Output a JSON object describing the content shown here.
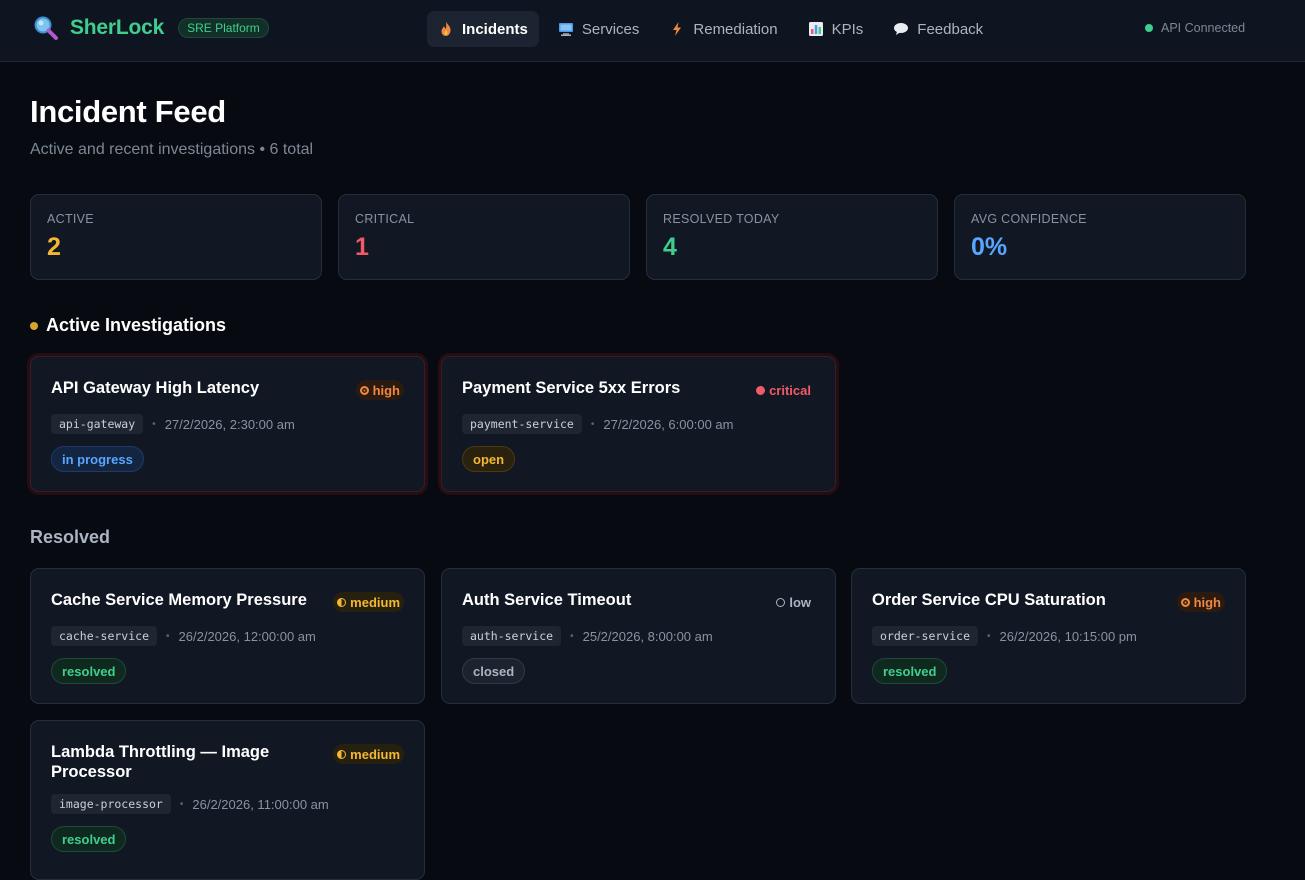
{
  "brand": {
    "name": "SherLock",
    "badge": "SRE Platform"
  },
  "nav": {
    "items": [
      {
        "label": "Incidents",
        "icon": "fire-icon"
      },
      {
        "label": "Services",
        "icon": "computer-icon"
      },
      {
        "label": "Remediation",
        "icon": "lightning-icon"
      },
      {
        "label": "KPIs",
        "icon": "bar-chart-icon"
      },
      {
        "label": "Feedback",
        "icon": "speech-bubble-icon"
      }
    ],
    "active": "Incidents"
  },
  "api_status": "API Connected",
  "header": {
    "title": "Incident Feed",
    "subtitle": "Active and recent investigations • 6 total"
  },
  "stats": [
    {
      "label": "ACTIVE",
      "value": "2",
      "color": "#f5b731"
    },
    {
      "label": "CRITICAL",
      "value": "1",
      "color": "#f25a67"
    },
    {
      "label": "RESOLVED TODAY",
      "value": "4",
      "color": "#3ecf8e"
    },
    {
      "label": "AVG CONFIDENCE",
      "value": "0%",
      "color": "#58a6ff"
    }
  ],
  "sections": {
    "active": "Active Investigations",
    "resolved": "Resolved"
  },
  "active_incidents": [
    {
      "title": "API Gateway High Latency",
      "severity": "high",
      "service": "api-gateway",
      "time": "27/2/2026, 2:30:00 am",
      "status": "in progress"
    },
    {
      "title": "Payment Service 5xx Errors",
      "severity": "critical",
      "service": "payment-service",
      "time": "27/2/2026, 6:00:00 am",
      "status": "open"
    }
  ],
  "resolved_incidents": [
    {
      "title": "Cache Service Memory Pressure",
      "severity": "medium",
      "service": "cache-service",
      "time": "26/2/2026, 12:00:00 am",
      "status": "resolved"
    },
    {
      "title": "Auth Service Timeout",
      "severity": "low",
      "service": "auth-service",
      "time": "25/2/2026, 8:00:00 am",
      "status": "closed"
    },
    {
      "title": "Order Service CPU Saturation",
      "severity": "high",
      "service": "order-service",
      "time": "26/2/2026, 10:15:00 pm",
      "status": "resolved"
    },
    {
      "title": "Lambda Throttling — Image Processor",
      "severity": "medium",
      "service": "image-processor",
      "time": "26/2/2026, 11:00:00 am",
      "status": "resolved"
    }
  ],
  "separator": "•",
  "colors": {
    "accent": "#3ecf8e",
    "severity_high": "#f0883e",
    "severity_critical": "#f25a67",
    "severity_medium": "#f5b731",
    "severity_low": "#aab4c2",
    "status_in_progress": "#58a6ff",
    "status_open": "#f5b731",
    "status_resolved": "#3ecf8e",
    "status_closed": "#aab4c2"
  }
}
